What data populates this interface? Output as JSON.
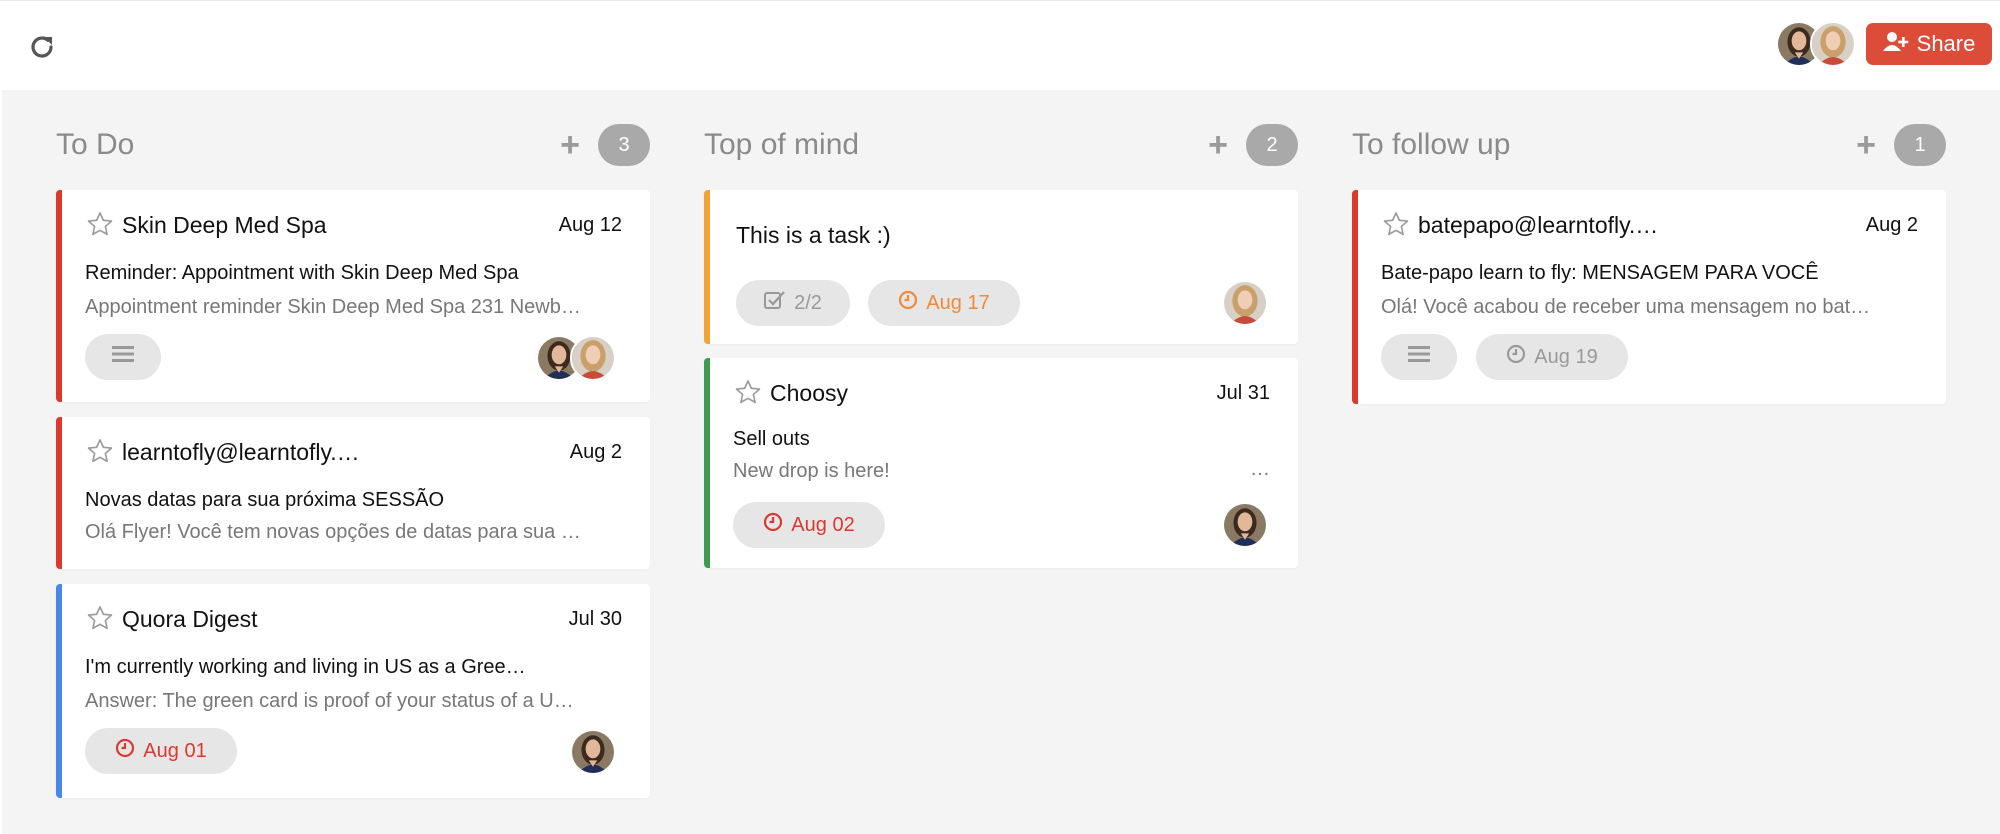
{
  "toolbar": {
    "share_label": "Share",
    "colors": {
      "share_bg": "#dd4b39"
    }
  },
  "icons": [
    "refresh-icon",
    "add-user-icon",
    "star-icon",
    "notes-icon",
    "clock-icon",
    "checkbox-icon",
    "ellipsis-icon"
  ],
  "columns": [
    {
      "title": "To Do",
      "add_label": "+",
      "count": "3",
      "cards": [
        {
          "sender": "Skin Deep Med Spa",
          "date": "Aug 12",
          "subject": "Reminder: Appointment with Skin Deep Med Spa",
          "snippet": "Appointment reminder Skin Deep Med Spa 231 Newb…",
          "accent": "#d93a30"
        },
        {
          "sender": "learntofly@learntofly.…",
          "date": "Aug 2",
          "subject": "Novas datas para sua próxima SESSÃO",
          "snippet": "Olá Flyer! Você tem novas opções de datas para sua …",
          "accent": "#d93a30"
        },
        {
          "sender": "Quora Digest",
          "date": "Jul 30",
          "subject": "I'm currently working and living in US as a Gree…",
          "snippet": "Answer: The green card is proof of your status of a U…",
          "reminder": "Aug 01",
          "accent": "#4a86e8"
        }
      ]
    },
    {
      "title": "Top of mind",
      "add_label": "+",
      "count": "2",
      "cards": [
        {
          "title": "This is a task :)",
          "checklist": "2/2",
          "reminder": "Aug 17",
          "accent": "#f0a33a"
        },
        {
          "sender": "Choosy",
          "date": "Jul 31",
          "subject": "Sell outs",
          "snippet": "New drop is here!",
          "more": "…",
          "reminder": "Aug 02",
          "accent": "#3f9a4f"
        }
      ]
    },
    {
      "title": "To follow up",
      "add_label": "+",
      "count": "1",
      "cards": [
        {
          "sender": "batepapo@learntofly.…",
          "date": "Aug 2",
          "subject": "Bate-papo learn to fly: MENSAGEM PARA VOCÊ",
          "snippet": "Olá! Você acabou de receber uma mensagem no bat…",
          "reminder": "Aug 19",
          "accent": "#d93a30"
        }
      ]
    }
  ]
}
